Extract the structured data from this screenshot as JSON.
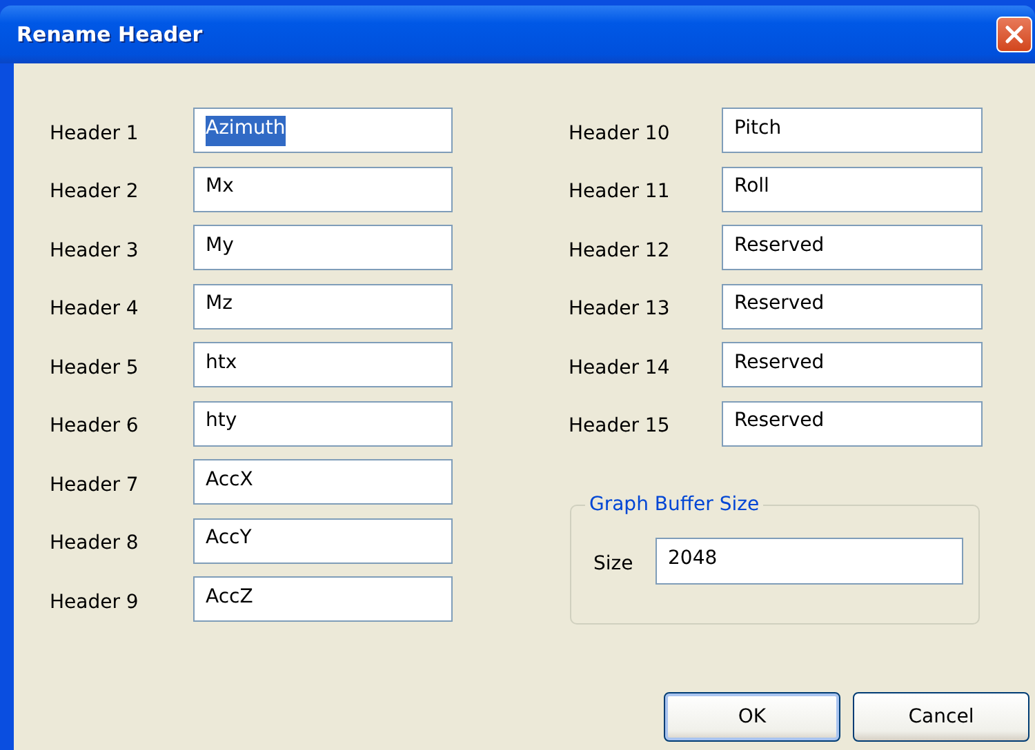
{
  "window": {
    "title": "Rename Header"
  },
  "headers_left": [
    {
      "label": "Header 1",
      "value": "Azimuth",
      "text_selected": true
    },
    {
      "label": "Header 2",
      "value": "Mx",
      "text_selected": false
    },
    {
      "label": "Header 3",
      "value": "My",
      "text_selected": false
    },
    {
      "label": "Header 4",
      "value": "Mz",
      "text_selected": false
    },
    {
      "label": "Header 5",
      "value": "htx",
      "text_selected": false
    },
    {
      "label": "Header 6",
      "value": "hty",
      "text_selected": false
    },
    {
      "label": "Header 7",
      "value": "AccX",
      "text_selected": false
    },
    {
      "label": "Header 8",
      "value": "AccY",
      "text_selected": false
    },
    {
      "label": "Header 9",
      "value": "AccZ",
      "text_selected": false
    }
  ],
  "headers_right": [
    {
      "label": "Header 10",
      "value": "Pitch",
      "text_selected": false
    },
    {
      "label": "Header 11",
      "value": "Roll",
      "text_selected": false
    },
    {
      "label": "Header 12",
      "value": "Reserved",
      "text_selected": false
    },
    {
      "label": "Header 13",
      "value": "Reserved",
      "text_selected": false
    },
    {
      "label": "Header 14",
      "value": "Reserved",
      "text_selected": false
    },
    {
      "label": "Header 15",
      "value": "Reserved",
      "text_selected": false
    }
  ],
  "graph_buffer": {
    "title": "Graph Buffer Size",
    "label": "Size",
    "value": "2048"
  },
  "buttons": [
    {
      "label": "OK",
      "default": true
    },
    {
      "label": "Cancel",
      "default": false
    }
  ]
}
